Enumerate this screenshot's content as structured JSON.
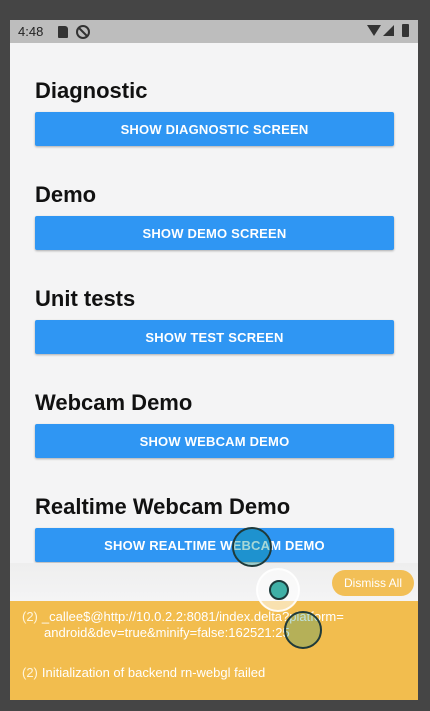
{
  "status_bar": {
    "time": "4:48",
    "icons": [
      "sd-card-icon",
      "block-icon",
      "wifi-icon",
      "signal-icon",
      "battery-icon"
    ]
  },
  "sections": [
    {
      "title": "Diagnostic",
      "button_label": "SHOW DIAGNOSTIC SCREEN"
    },
    {
      "title": "Demo",
      "button_label": "SHOW DEMO SCREEN"
    },
    {
      "title": "Unit tests",
      "button_label": "SHOW TEST SCREEN"
    },
    {
      "title": "Webcam Demo",
      "button_label": "SHOW WEBCAM DEMO"
    },
    {
      "title": "Realtime Webcam Demo",
      "button_label": "SHOW REALTIME WEBCAM DEMO"
    }
  ],
  "log_box": {
    "dismiss_label": "Dismiss All",
    "entries": [
      {
        "count": "(2)",
        "line1": "_callee$@http://10.0.2.2:8081/index.delta?platform=",
        "line2": "android&dev=true&minify=false:162521:25"
      },
      {
        "count": "(2)",
        "line1": "Initialization of backend rn-webgl failed"
      }
    ]
  },
  "colors": {
    "button": "#2f96f3",
    "log_background": "#f2bd4e",
    "screen_background": "#f4f4f5"
  }
}
